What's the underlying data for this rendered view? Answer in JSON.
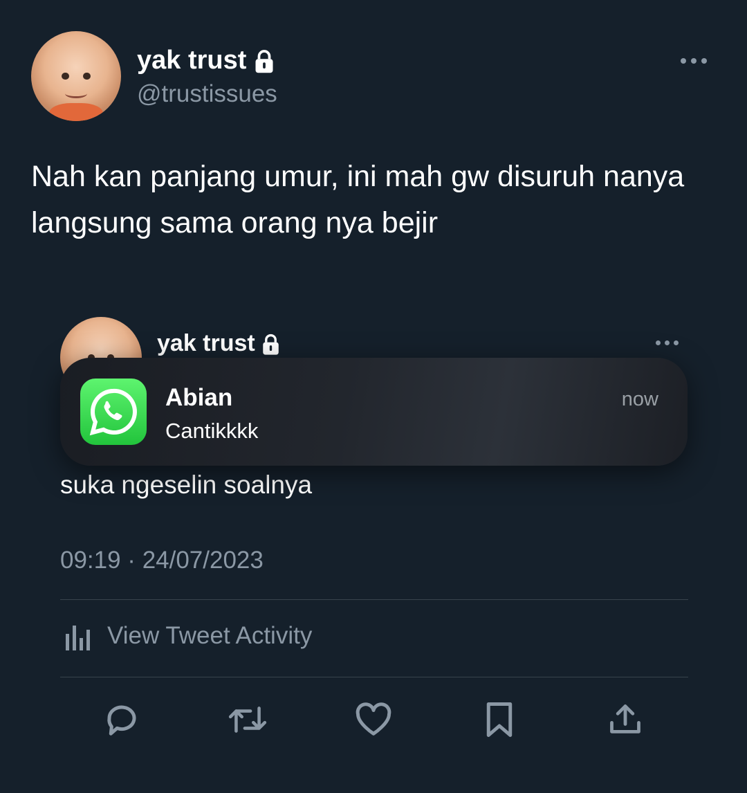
{
  "tweet": {
    "author_name": "yak trust",
    "author_handle": "@trustissues",
    "text": "Nah kan panjang umur, ini mah gw disuruh nanya langsung sama orang nya bejir"
  },
  "quoted": {
    "author_name": "yak trust",
    "text_visible": "suka ngeselin soalnya",
    "timestamp": "09:19 · 24/07/2023",
    "activity_label": "View Tweet Activity"
  },
  "notification": {
    "app_icon": "whatsapp-icon",
    "sender": "Abian",
    "message": "Cantikkkk",
    "time": "now"
  },
  "actions": [
    {
      "icon": "reply-icon"
    },
    {
      "icon": "retweet-icon"
    },
    {
      "icon": "like-icon"
    },
    {
      "icon": "bookmark-icon"
    },
    {
      "icon": "share-icon"
    }
  ],
  "colors": {
    "background": "#15202b",
    "secondary_text": "#8b98a5",
    "divider": "#38444d",
    "whatsapp_green": "#25d366"
  }
}
